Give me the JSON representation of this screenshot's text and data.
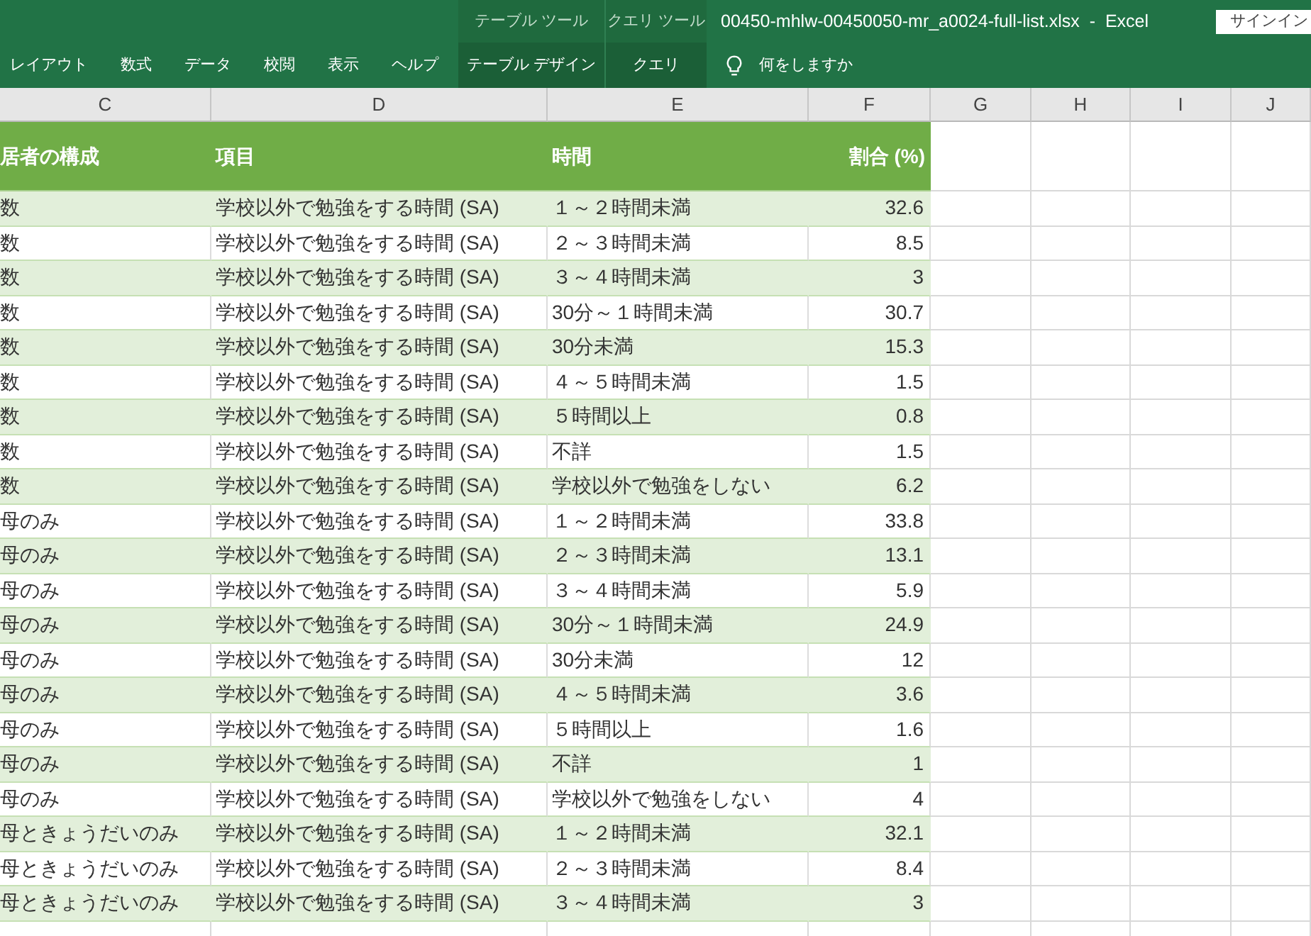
{
  "window": {
    "title": "00450-mhlw-00450050-mr_a0024-full-list.xlsx  -  Excel"
  },
  "sign_in_button": "サインイン",
  "ribbon_tabs": [
    {
      "label": "レイアウト",
      "selected": false
    },
    {
      "label": "数式",
      "selected": false
    },
    {
      "label": "データ",
      "selected": false
    },
    {
      "label": "校閲",
      "selected": false
    },
    {
      "label": "表示",
      "selected": false
    },
    {
      "label": "ヘルプ",
      "selected": false
    }
  ],
  "contextual_tabs": [
    {
      "group": "テーブル ツール",
      "label": "テーブル デザイン",
      "selected": false
    },
    {
      "group": "クエリ ツール",
      "label": "クエリ",
      "selected": false
    }
  ],
  "tell_me": {
    "placeholder": "何をしますか"
  },
  "column_headers": [
    "C",
    "D",
    "E",
    "F",
    "G",
    "H",
    "I",
    "J"
  ],
  "table": {
    "columns": [
      "居者の構成",
      "項目",
      "時間",
      "割合 (%)"
    ],
    "rows": [
      [
        "数",
        "学校以外で勉強をする時間 (SA)",
        "１～２時間未満",
        "32.6"
      ],
      [
        "数",
        "学校以外で勉強をする時間 (SA)",
        "２～３時間未満",
        "8.5"
      ],
      [
        "数",
        "学校以外で勉強をする時間 (SA)",
        "３～４時間未満",
        "3"
      ],
      [
        "数",
        "学校以外で勉強をする時間 (SA)",
        "30分～１時間未満",
        "30.7"
      ],
      [
        "数",
        "学校以外で勉強をする時間 (SA)",
        "30分未満",
        "15.3"
      ],
      [
        "数",
        "学校以外で勉強をする時間 (SA)",
        "４～５時間未満",
        "1.5"
      ],
      [
        "数",
        "学校以外で勉強をする時間 (SA)",
        "５時間以上",
        "0.8"
      ],
      [
        "数",
        "学校以外で勉強をする時間 (SA)",
        "不詳",
        "1.5"
      ],
      [
        "数",
        "学校以外で勉強をする時間 (SA)",
        "学校以外で勉強をしない",
        "6.2"
      ],
      [
        "母のみ",
        "学校以外で勉強をする時間 (SA)",
        "１～２時間未満",
        "33.8"
      ],
      [
        "母のみ",
        "学校以外で勉強をする時間 (SA)",
        "２～３時間未満",
        "13.1"
      ],
      [
        "母のみ",
        "学校以外で勉強をする時間 (SA)",
        "３～４時間未満",
        "5.9"
      ],
      [
        "母のみ",
        "学校以外で勉強をする時間 (SA)",
        "30分～１時間未満",
        "24.9"
      ],
      [
        "母のみ",
        "学校以外で勉強をする時間 (SA)",
        "30分未満",
        "12"
      ],
      [
        "母のみ",
        "学校以外で勉強をする時間 (SA)",
        "４～５時間未満",
        "3.6"
      ],
      [
        "母のみ",
        "学校以外で勉強をする時間 (SA)",
        "５時間以上",
        "1.6"
      ],
      [
        "母のみ",
        "学校以外で勉強をする時間 (SA)",
        "不詳",
        "1"
      ],
      [
        "母のみ",
        "学校以外で勉強をする時間 (SA)",
        "学校以外で勉強をしない",
        "4"
      ],
      [
        "母ときょうだいのみ",
        "学校以外で勉強をする時間 (SA)",
        "１～２時間未満",
        "32.1"
      ],
      [
        "母ときょうだいのみ",
        "学校以外で勉強をする時間 (SA)",
        "２～３時間未満",
        "8.4"
      ],
      [
        "母ときょうだいのみ",
        "学校以外で勉強をする時間 (SA)",
        "３～４時間未満",
        "3"
      ]
    ]
  }
}
